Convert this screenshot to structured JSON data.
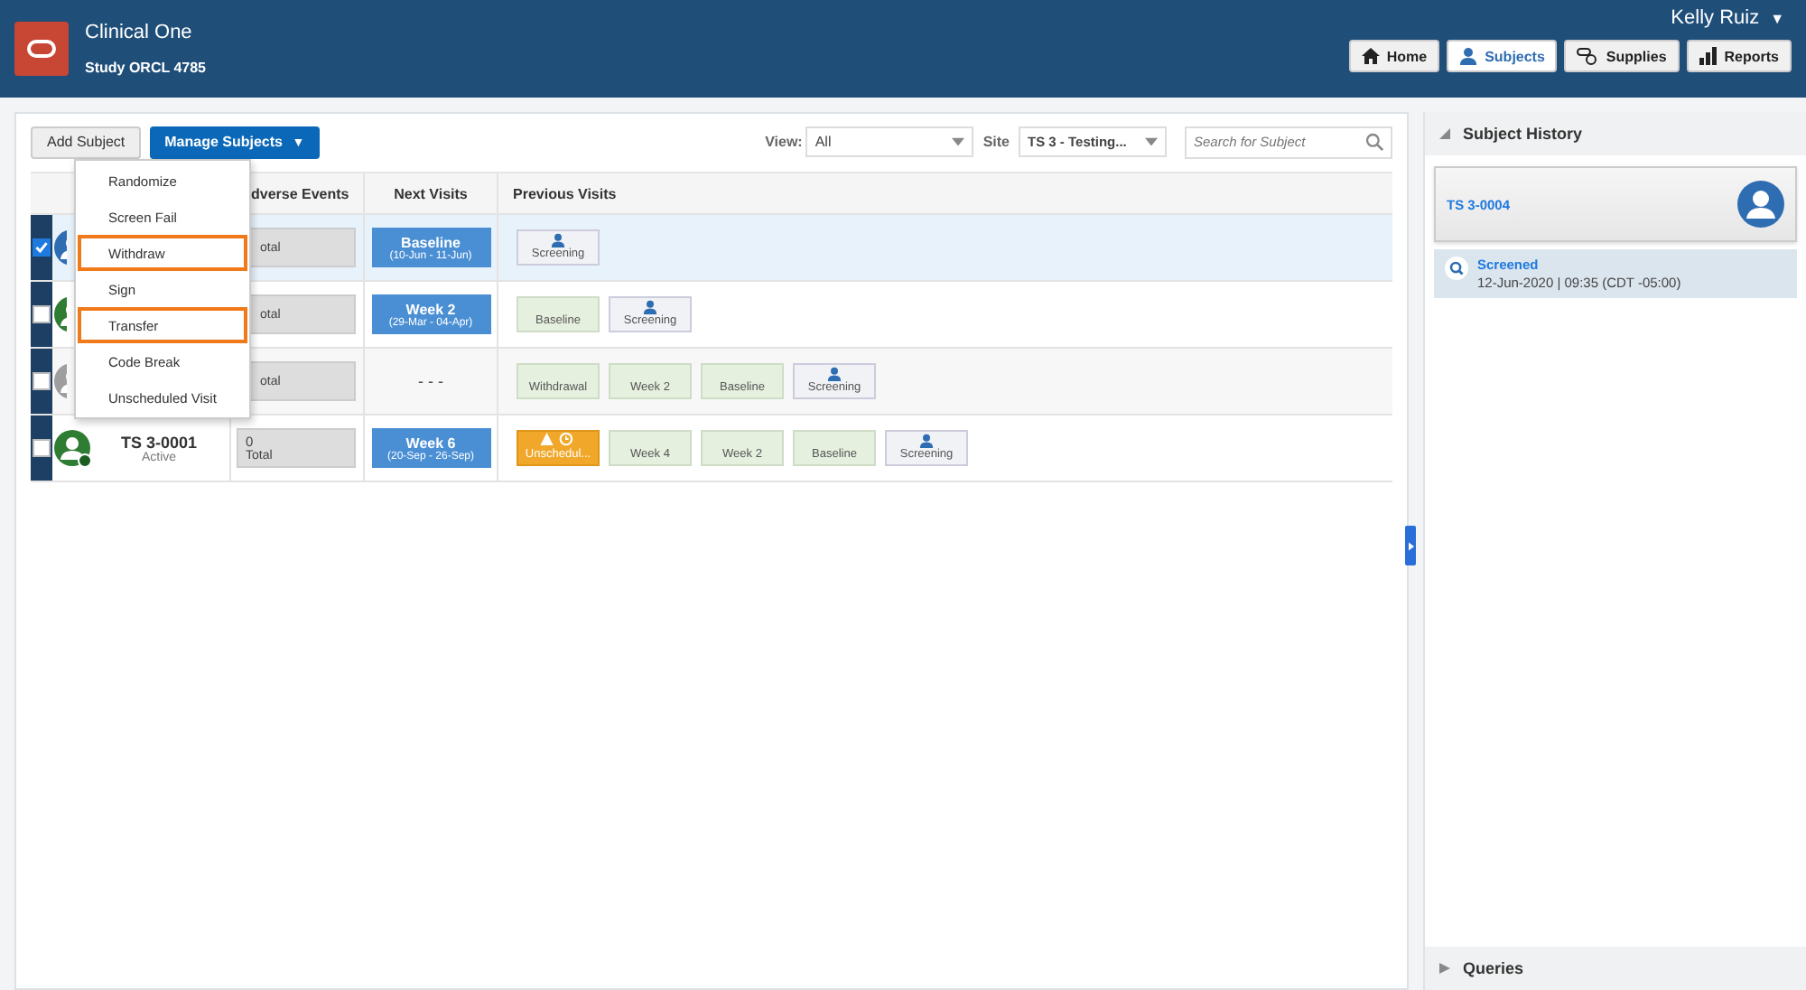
{
  "header": {
    "app_name": "Clinical One",
    "study": "Study ORCL 4785",
    "user": "Kelly Ruiz",
    "user_caret": "▼",
    "nav": [
      {
        "label": "Home",
        "selected": false
      },
      {
        "label": "Subjects",
        "selected": true
      },
      {
        "label": "Supplies",
        "selected": false
      },
      {
        "label": "Reports",
        "selected": false
      }
    ]
  },
  "toolbar": {
    "add_button": "Add Subject",
    "manage_button": {
      "label": "Manage Subjects",
      "caret": "▼",
      "expanded": true
    },
    "view": {
      "label": "View:",
      "value": "All"
    },
    "site": {
      "label": "Site",
      "value": "TS 3 - Testing..."
    },
    "search": {
      "placeholder": "Search for Subject"
    }
  },
  "menu": [
    {
      "label": "Randomize",
      "highlighted": false
    },
    {
      "label": "Screen Fail",
      "highlighted": false
    },
    {
      "label": "Withdraw",
      "highlighted": true
    },
    {
      "label": "Sign",
      "highlighted": false
    },
    {
      "label": "Transfer",
      "highlighted": true
    },
    {
      "label": "Code Break",
      "highlighted": false
    },
    {
      "label": "Unscheduled Visit",
      "highlighted": false
    }
  ],
  "table": {
    "columns": [
      "dverse Events",
      "Next Visits",
      "Previous Visits"
    ],
    "rows": [
      {
        "selected": true,
        "checked": true,
        "color": "#2f6db3",
        "adverse": {
          "label": "otal"
        },
        "next": {
          "kind": "visit",
          "title": "Baseline",
          "dates": "(10-Jun - 11-Jun)"
        },
        "previous": [
          {
            "kind": "screening",
            "label": "Screening"
          }
        ]
      },
      {
        "selected": false,
        "checked": false,
        "color": "#2e7d32",
        "adverse": {
          "label": "otal"
        },
        "next": {
          "kind": "visit",
          "title": "Week 2",
          "dates": "(29-Mar - 04-Apr)"
        },
        "previous": [
          {
            "kind": "visit",
            "label": "Baseline"
          },
          {
            "kind": "screening",
            "label": "Screening"
          }
        ]
      },
      {
        "selected": false,
        "checked": false,
        "color": "#9e9e9e",
        "adverse": {
          "label": "otal"
        },
        "next": {
          "kind": "none",
          "text": "- - -"
        },
        "previous": [
          {
            "kind": "visit",
            "label": "Withdrawal"
          },
          {
            "kind": "visit",
            "label": "Week 2"
          },
          {
            "kind": "visit",
            "label": "Baseline"
          },
          {
            "kind": "screening",
            "label": "Screening"
          }
        ]
      },
      {
        "selected": false,
        "checked": false,
        "color": "#2e7d32",
        "id": "TS 3-0001",
        "status": "Active",
        "adverse": {
          "count": "0",
          "label": "Total"
        },
        "next": {
          "kind": "visit",
          "title": "Week 6",
          "dates": "(20-Sep - 26-Sep)"
        },
        "previous": [
          {
            "kind": "unscheduled",
            "label": "Unschedul..."
          },
          {
            "kind": "visit",
            "label": "Week 4"
          },
          {
            "kind": "visit",
            "label": "Week 2"
          },
          {
            "kind": "visit",
            "label": "Baseline"
          },
          {
            "kind": "screening",
            "label": "Screening"
          }
        ]
      }
    ]
  },
  "history": {
    "title": "Subject History",
    "expanded": true,
    "subject": "TS 3-0004",
    "events": [
      {
        "title": "Screened",
        "time": "12-Jun-2020 | 09:35 (CDT -05:00)"
      }
    ]
  },
  "queries": {
    "title": "Queries",
    "expanded": false
  }
}
